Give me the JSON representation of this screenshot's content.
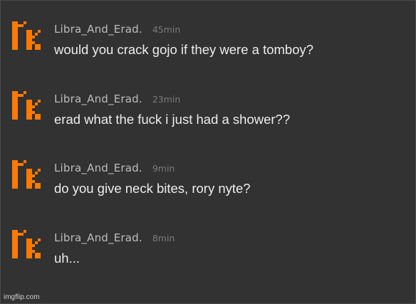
{
  "theme": {
    "background": "#323232",
    "avatar_color": "#ff7b00",
    "username_color": "#bdbdbd",
    "time_color": "#7a7a7a",
    "message_color": "#ececec"
  },
  "comments": [
    {
      "username": "Libra_And_Erad.",
      "time": "45min",
      "text": "would you crack gojo if they were a tomboy?",
      "avatar_icon": "pixel-avatar-icon"
    },
    {
      "username": "Libra_And_Erad.",
      "time": "23min",
      "text": "erad what the fuck i just had a shower??",
      "avatar_icon": "pixel-avatar-icon"
    },
    {
      "username": "Libra_And_Erad.",
      "time": "9min",
      "text": "do you give neck bites, rory nyte?",
      "avatar_icon": "pixel-avatar-icon"
    },
    {
      "username": "Libra_And_Erad.",
      "time": "8min",
      "text": "uh...",
      "avatar_icon": "pixel-avatar-icon"
    }
  ],
  "watermark": "imgflip.com"
}
